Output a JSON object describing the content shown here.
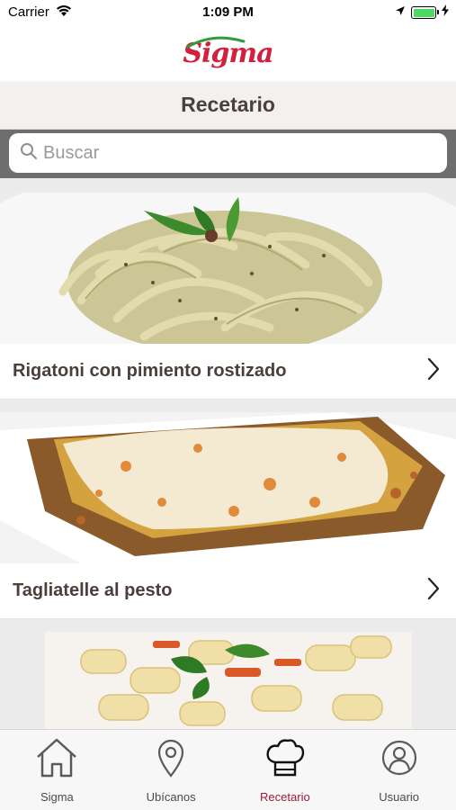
{
  "status_bar": {
    "carrier": "Carrier",
    "time": "1:09 PM"
  },
  "brand": {
    "logo_text": "Sigma"
  },
  "header": {
    "title": "Recetario"
  },
  "search": {
    "placeholder": "Buscar",
    "value": ""
  },
  "recipes": [
    {
      "title": "Rigatoni con pimiento rostizado",
      "image": "pasta-pesto-photo"
    },
    {
      "title": "Tagliatelle al pesto",
      "image": "lasagna-photo"
    },
    {
      "title": "",
      "image": "rigatoni-photo"
    }
  ],
  "tabs": [
    {
      "label": "Sigma",
      "icon": "home-icon",
      "active": false
    },
    {
      "label": "Ubícanos",
      "icon": "location-pin-icon",
      "active": false
    },
    {
      "label": "Recetario",
      "icon": "chef-hat-icon",
      "active": true
    },
    {
      "label": "Usuario",
      "icon": "user-icon",
      "active": false
    }
  ],
  "colors": {
    "brand": "#d2203f",
    "active_tab": "#a01a3a",
    "search_bar_bg": "#6e6e6e",
    "battery": "#4cd964"
  }
}
